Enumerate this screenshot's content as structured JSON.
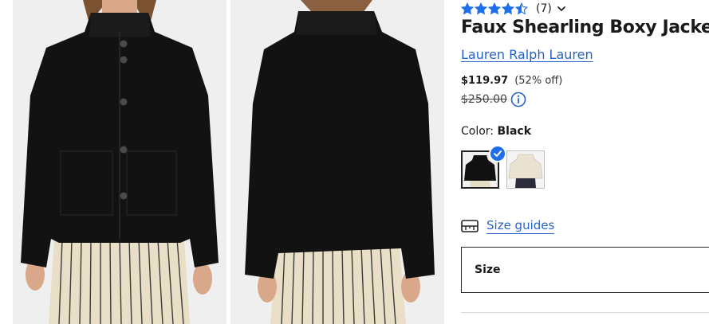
{
  "product": {
    "rating": {
      "value": 4.5,
      "max": 5,
      "count_label": "(7)"
    },
    "title": "Faux Shearling Boxy Jacket",
    "brand": "Lauren Ralph Lauren",
    "price": {
      "current": "$119.97",
      "discount": "(52% off)",
      "original": "$250.00"
    },
    "color": {
      "label": "Color:",
      "value": "Black"
    },
    "swatches": [
      {
        "color": "#111111",
        "selected": true
      },
      {
        "color": "#ece6da",
        "selected": false
      }
    ],
    "size_guides": "Size guides",
    "size_select": "Size"
  },
  "colors": {
    "link": "#2564c5",
    "star": "#1f6feb",
    "badge": "#1f6feb"
  },
  "icons": {
    "star": "star-icon",
    "chevron": "chevron-down-icon",
    "info": "info-icon",
    "check": "checkmark-icon",
    "size_guide": "ruler-icon"
  }
}
